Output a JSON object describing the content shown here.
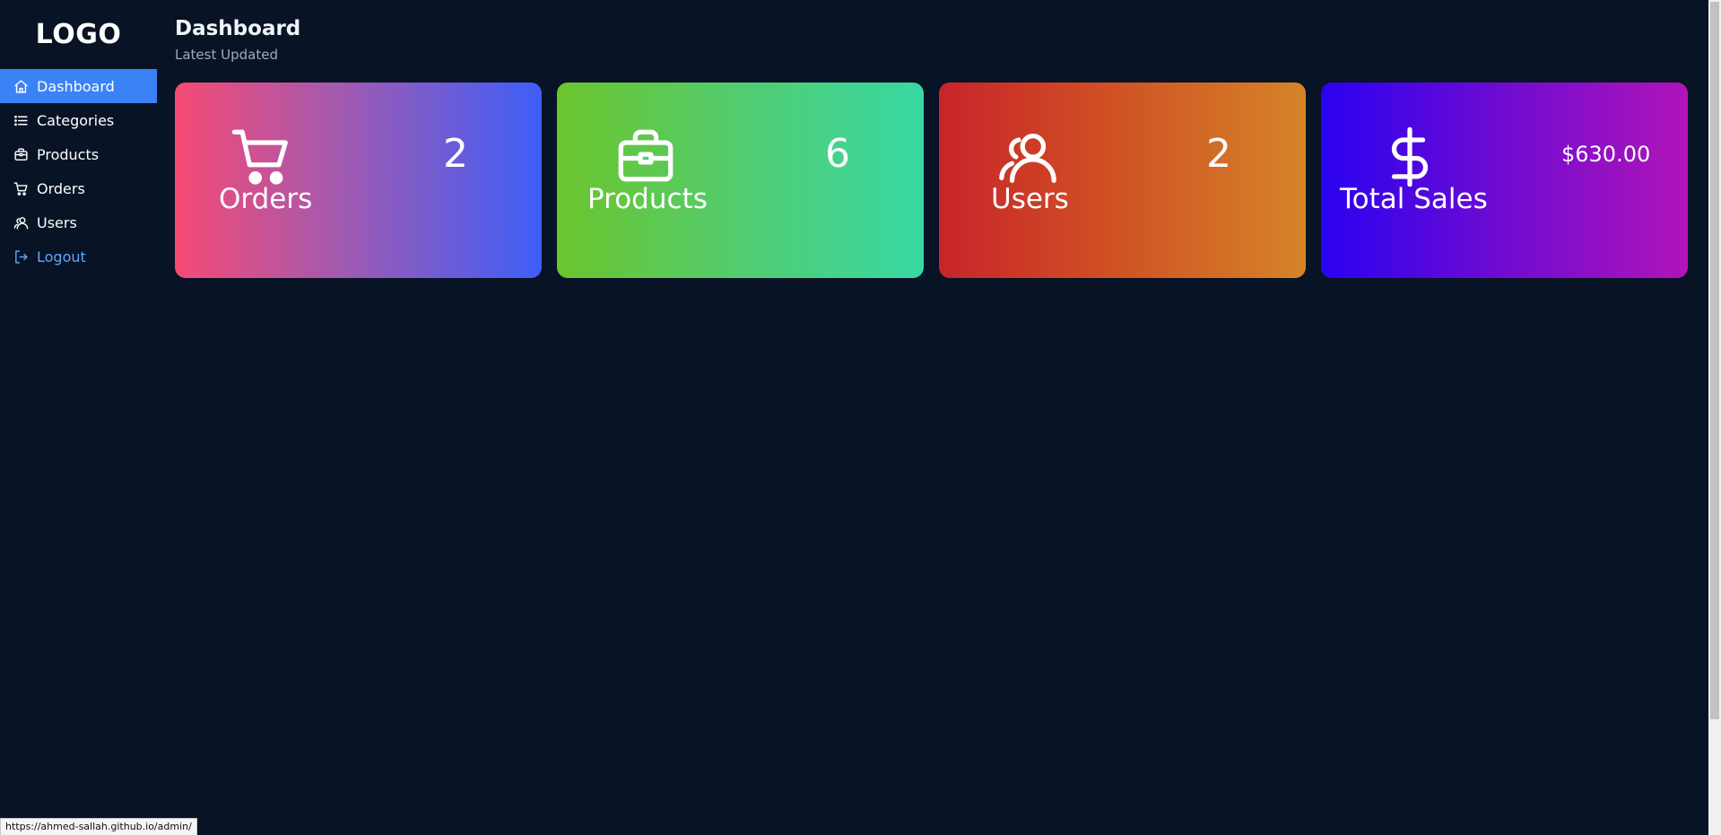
{
  "sidebar": {
    "logo": "LOGO",
    "items": [
      {
        "label": "Dashboard",
        "icon": "home-icon",
        "active": true
      },
      {
        "label": "Categories",
        "icon": "list-icon"
      },
      {
        "label": "Products",
        "icon": "briefcase-icon"
      },
      {
        "label": "Orders",
        "icon": "cart-icon"
      },
      {
        "label": "Users",
        "icon": "users-icon"
      },
      {
        "label": "Logout",
        "icon": "logout-icon"
      }
    ]
  },
  "header": {
    "title": "Dashboard",
    "subtitle": "Latest Updated"
  },
  "cards": [
    {
      "label": "Orders",
      "value": "2",
      "icon": "cart-icon"
    },
    {
      "label": "Products",
      "value": "6",
      "icon": "briefcase-icon"
    },
    {
      "label": "Users",
      "value": "2",
      "icon": "users-icon"
    },
    {
      "label": "Total Sales",
      "value": "$630.00",
      "icon": "dollar-icon"
    }
  ],
  "status_bar": {
    "url": "https://ahmed-sallah.github.io/admin/"
  },
  "colors": {
    "background": "#081325",
    "active_nav": "#3b82f6",
    "logout": "#60a5fa"
  }
}
